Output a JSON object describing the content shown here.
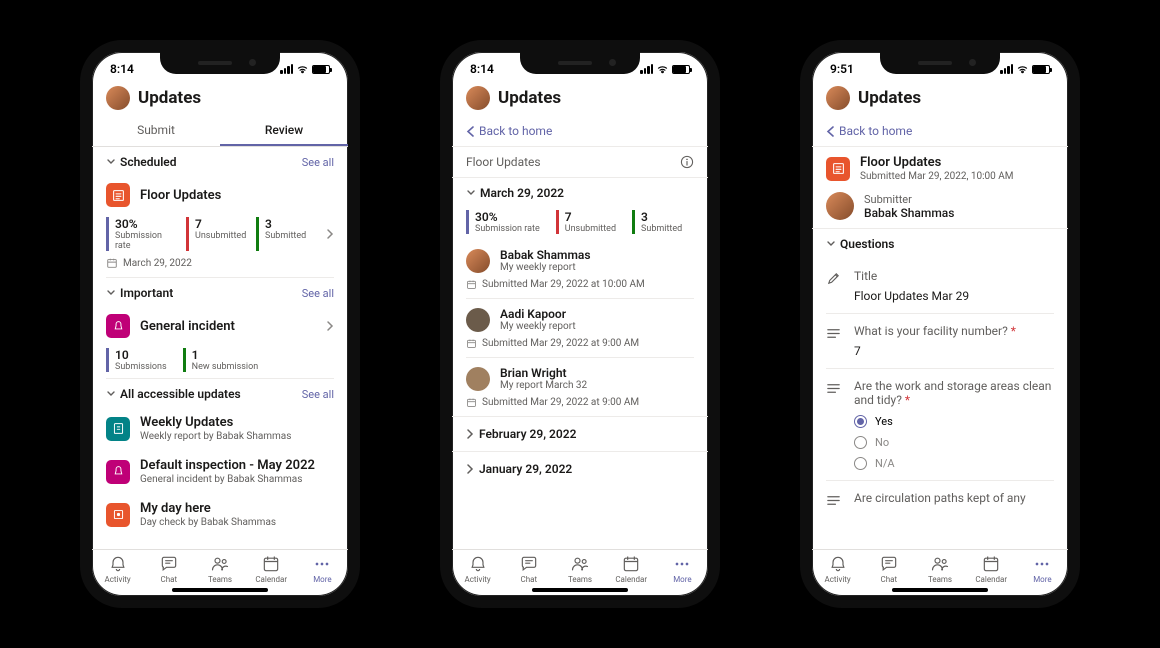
{
  "nav": {
    "activity": "Activity",
    "chat": "Chat",
    "teams": "Teams",
    "calendar": "Calendar",
    "more": "More"
  },
  "phone1": {
    "time": "8:14",
    "app_title": "Updates",
    "tabs": {
      "submit": "Submit",
      "review": "Review"
    },
    "scheduled": {
      "title": "Scheduled",
      "seeall": "See all",
      "item_title": "Floor Updates",
      "stats": [
        {
          "num": "30%",
          "lbl": "Submission rate"
        },
        {
          "num": "7",
          "lbl": "Unsubmitted"
        },
        {
          "num": "3",
          "lbl": "Submitted"
        }
      ],
      "date": "March 29, 2022"
    },
    "important": {
      "title": "Important",
      "seeall": "See all",
      "item_title": "General incident",
      "stats": [
        {
          "num": "10",
          "lbl": "Submissions"
        },
        {
          "num": "1",
          "lbl": "New submission"
        }
      ]
    },
    "accessible": {
      "title": "All accessible updates",
      "seeall": "See all",
      "items": [
        {
          "title": "Weekly Updates",
          "sub": "Weekly report by Babak Shammas"
        },
        {
          "title": "Default inspection - May 2022",
          "sub": "General incident by Babak Shammas"
        },
        {
          "title": "My day here",
          "sub": "Day check by Babak Shammas"
        }
      ]
    }
  },
  "phone2": {
    "time": "8:14",
    "app_title": "Updates",
    "back": "Back to home",
    "subhead": "Floor Updates",
    "date": "March 29, 2022",
    "stats": [
      {
        "num": "30%",
        "lbl": "Submission rate"
      },
      {
        "num": "7",
        "lbl": "Unsubmitted"
      },
      {
        "num": "3",
        "lbl": "Submitted"
      }
    ],
    "entries": [
      {
        "name": "Babak Shammas",
        "sub": "My weekly report",
        "meta": "Submitted Mar 29, 2022 at 10:00 AM"
      },
      {
        "name": "Aadi Kapoor",
        "sub": "My weekly report",
        "meta": "Submitted Mar 29, 2022 at 9:00 AM"
      },
      {
        "name": "Brian Wright",
        "sub": "My report March 32",
        "meta": "Submitted Mar 29, 2022 at 9:00 AM"
      }
    ],
    "months": [
      "February 29, 2022",
      "January 29, 2022"
    ]
  },
  "phone3": {
    "time": "9:51",
    "app_title": "Updates",
    "back": "Back to home",
    "item": {
      "title": "Floor Updates",
      "sub": "Submitted Mar 29, 2022, 10:00 AM"
    },
    "submitter": {
      "label": "Submitter",
      "name": "Babak Shammas"
    },
    "questions_title": "Questions",
    "q_title": {
      "label": "Title",
      "value": "Floor Updates Mar 29"
    },
    "q_facility": {
      "label": "What is your facility number?",
      "value": "7"
    },
    "q_clean": {
      "label": "Are the work and storage areas clean and tidy?",
      "options": [
        "Yes",
        "No",
        "N/A"
      ],
      "selected": "Yes"
    },
    "q_circulation": {
      "label": "Are circulation paths kept of any"
    }
  }
}
